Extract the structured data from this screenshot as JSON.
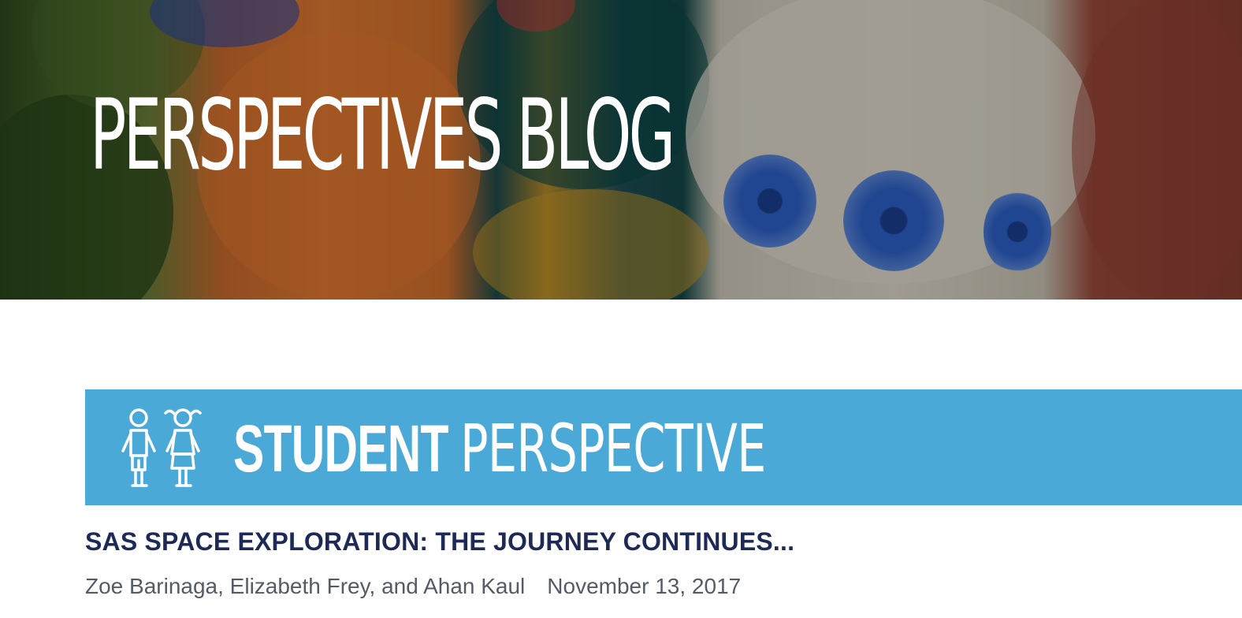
{
  "hero": {
    "title": "PERSPECTIVES BLOG"
  },
  "banner": {
    "icon": "two-children-icon",
    "bold_text": "STUDENT",
    "light_text": "PERSPECTIVE",
    "background_color": "#4aa9d6"
  },
  "post": {
    "title": "SAS SPACE EXPLORATION: THE JOURNEY CONTINUES...",
    "authors": "Zoe Barinaga, Elizabeth Frey, and Ahan Kaul",
    "date": "November 13, 2017"
  },
  "colors": {
    "title_navy": "#1e2a55",
    "meta_gray": "#555b66"
  }
}
